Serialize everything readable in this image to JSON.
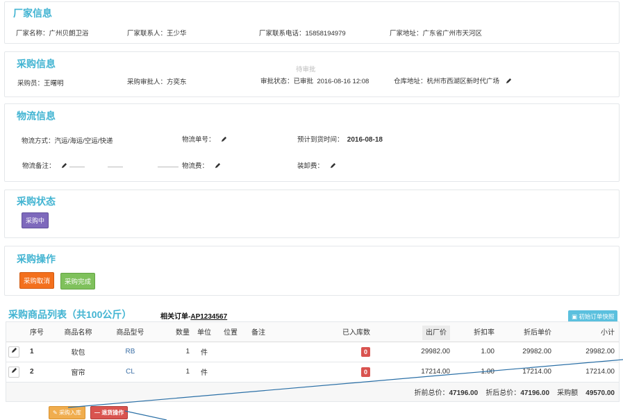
{
  "factory": {
    "title": "厂家信息",
    "name_label": "厂家名称：",
    "name_value": "广州贝朗卫浴",
    "contact_label": "厂家联系人：",
    "contact_value": "王少华",
    "phone_label": "厂家联系电话：",
    "phone_value": "15858194979",
    "address_label": "厂家地址：",
    "address_value": "广东省广州市天河区"
  },
  "purchase": {
    "title": "采购信息",
    "faded_status": "待审批",
    "buyer_label": "采购员：",
    "buyer_value": "王曙明",
    "approver_label": "采购审批人：",
    "approver_value": "方奕东",
    "status_label": "审批状态：",
    "status_value": "已审批",
    "status_time": "2016-08-16 12:08",
    "warehouse_label": "仓库地址：",
    "warehouse_value": "杭州市西湖区新时代广场"
  },
  "logistics": {
    "title": "物流信息",
    "method_label": "物流方式：",
    "method_value": "汽运/海运/空运/快递",
    "tracking_label": "物流单号：",
    "eta_label": "预计到货时间：",
    "eta_value": "2016-08-18",
    "remark_label": "物流备注：",
    "fee_label": "物流费：",
    "handling_label": "装卸费："
  },
  "state": {
    "title": "采购状态",
    "badge": "采购中"
  },
  "operation": {
    "title": "采购操作",
    "cancel_button": "采购取消",
    "complete_button": "采购完成"
  },
  "list": {
    "title_prefix": "采购商品列表（共",
    "title_amount": "100公斤",
    "title_suffix": "）",
    "related_label": "相关订单-",
    "related_order": "AP1234567",
    "snapshot_button": "初始订单快照",
    "columns": [
      "序号",
      "商品名称",
      "商品型号",
      "数量",
      "单位",
      "位置",
      "备注",
      "已入库数",
      "出厂价",
      "折扣率",
      "折后单价",
      "小计"
    ],
    "rows": [
      {
        "index": "1",
        "name": "软包",
        "model": "RB",
        "qty": "1",
        "unit": "件",
        "stocked": "0",
        "price": "29982.00",
        "discount": "1.00",
        "unit_after": "29982.00",
        "subtotal": "29982.00"
      },
      {
        "index": "2",
        "name": "窗帘",
        "model": "CL",
        "qty": "1",
        "unit": "件",
        "stocked": "0",
        "price": "17214.00",
        "discount": "1.00",
        "unit_after": "17214.00",
        "subtotal": "17214.00"
      }
    ],
    "totals": {
      "before_label": "折前总价：",
      "before_value": "47196.00",
      "after_label": "折后总价：",
      "after_value": "47196.00",
      "amount_label": "采购额",
      "amount_value": "49570.00"
    },
    "stock_in_button": "采购入库",
    "return_button": "退货操作"
  }
}
